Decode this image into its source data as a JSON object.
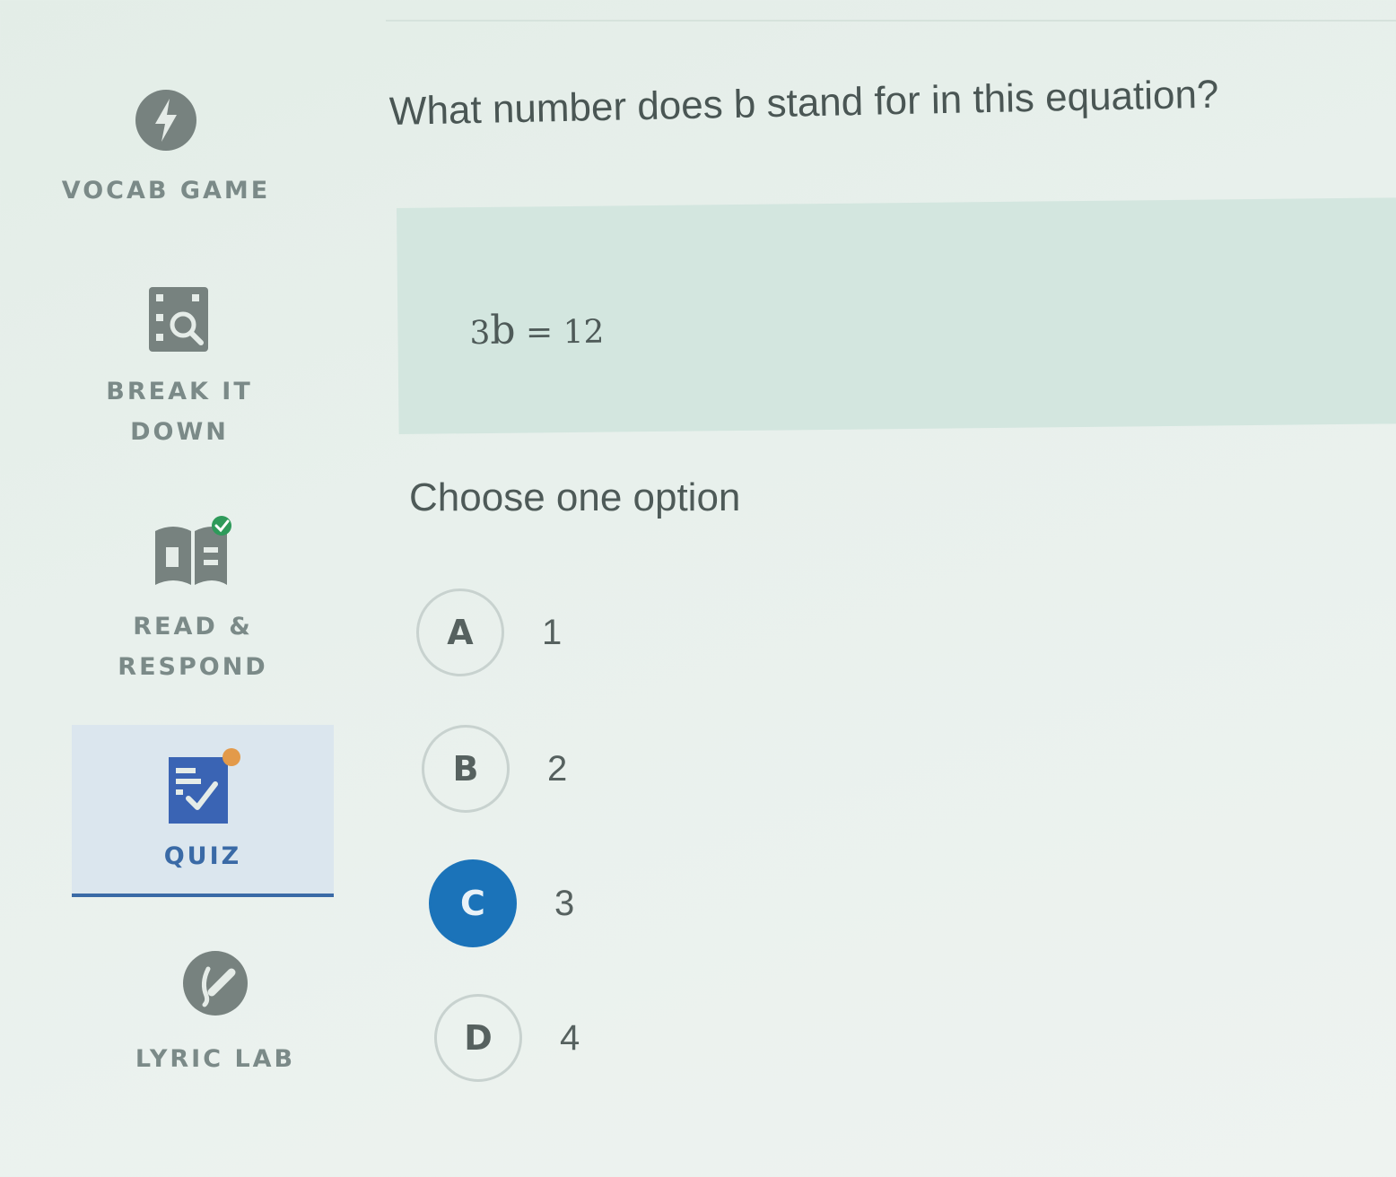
{
  "sidebar": {
    "items": [
      {
        "label": "VOCAB GAME",
        "icon": "lightning-icon"
      },
      {
        "label": "BREAK IT\nDOWN",
        "icon": "magnifier-icon"
      },
      {
        "label": "READ &\nRESPOND",
        "icon": "open-book-icon"
      },
      {
        "label": "QUIZ",
        "icon": "quiz-checklist-icon",
        "active": true
      },
      {
        "label": "LYRIC LAB",
        "icon": "microphone-icon"
      }
    ]
  },
  "question": {
    "prompt": "What number does b stand for in this equation?",
    "equation_coef": "3",
    "equation_var": "b",
    "equation_rest": " = 12"
  },
  "choose_label": "Choose one option",
  "options": [
    {
      "letter": "A",
      "value": "1",
      "selected": false
    },
    {
      "letter": "B",
      "value": "2",
      "selected": false
    },
    {
      "letter": "C",
      "value": "3",
      "selected": true
    },
    {
      "letter": "D",
      "value": "4",
      "selected": false
    }
  ],
  "colors": {
    "accent": "#1b73b9",
    "active_nav": "#3a6aa6",
    "notification_dot": "#e39a4a",
    "check_badge": "#2e9a5a"
  }
}
